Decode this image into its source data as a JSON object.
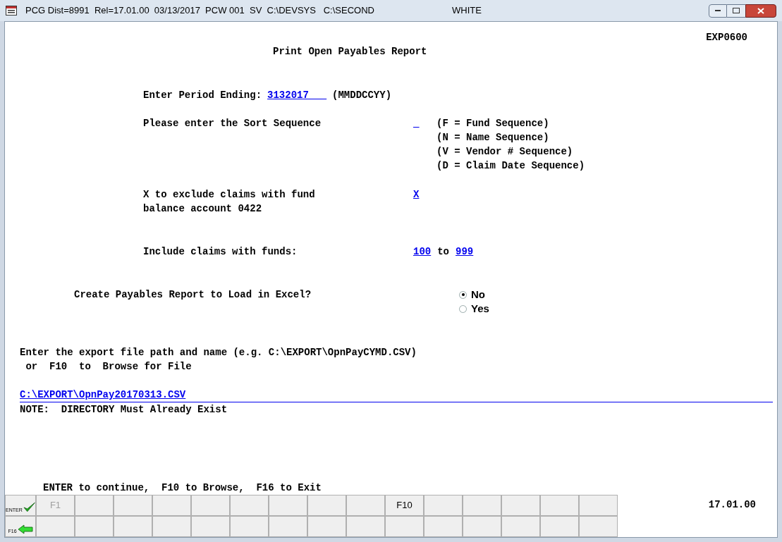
{
  "window": {
    "title": "PCG Dist=8991  Rel=17.01.00  03/13/2017  PCW 001  SV  C:\\DEVSYS   C:\\SECOND",
    "user": "WHITE"
  },
  "screen_id": "EXP0600",
  "heading": "Print Open Payables Report",
  "period": {
    "label": "Enter Period Ending:",
    "value": "3132017___",
    "hint": "(MMDDCCYY)"
  },
  "sort": {
    "label": "Please enter the Sort Sequence",
    "value": "_",
    "options": [
      "(F = Fund Sequence)",
      "(N = Name Sequence)",
      "(V = Vendor # Sequence)",
      "(D = Claim Date Sequence)"
    ]
  },
  "exclude": {
    "label_lines": [
      "X to exclude claims with fund",
      "balance account 0422"
    ],
    "value": "X"
  },
  "funds": {
    "label": "Include claims with funds:",
    "from": "100",
    "to_word": "to",
    "to": "999"
  },
  "excel": {
    "label": "Create Payables Report to Load in Excel?",
    "options": [
      {
        "label": "No",
        "selected": true
      },
      {
        "label": "Yes",
        "selected": false
      }
    ]
  },
  "export": {
    "prompt_lines": [
      "Enter the export file path and name (e.g. C:\\EXPORT\\OpnPayCYMD.CSV)",
      " or  F10  to  Browse for File"
    ],
    "path": "C:\\EXPORT\\OpnPay20170313.CSV",
    "note": "NOTE:  DIRECTORY Must Already Exist"
  },
  "instructions": "ENTER to continue,  F10 to Browse,  F16 to Exit",
  "version": "17.01.00",
  "key_rows": [
    {
      "icon_label": "ENTER",
      "kind": "check",
      "keys": [
        {
          "kind": "key",
          "label": "F1",
          "disabled": true
        },
        {
          "kind": "blank"
        },
        {
          "kind": "blank"
        },
        {
          "kind": "blank"
        },
        {
          "kind": "blank"
        },
        {
          "kind": "blank"
        },
        {
          "kind": "blank"
        },
        {
          "kind": "blank"
        },
        {
          "kind": "blank"
        },
        {
          "kind": "key",
          "label": "F10",
          "disabled": false
        },
        {
          "kind": "blank"
        },
        {
          "kind": "blank"
        },
        {
          "kind": "blank"
        },
        {
          "kind": "blank"
        },
        {
          "kind": "blank"
        }
      ]
    },
    {
      "icon_label": "F16",
      "kind": "arrow",
      "keys": [
        {
          "kind": "blank"
        },
        {
          "kind": "blank"
        },
        {
          "kind": "blank"
        },
        {
          "kind": "blank"
        },
        {
          "kind": "blank"
        },
        {
          "kind": "blank"
        },
        {
          "kind": "blank"
        },
        {
          "kind": "blank"
        },
        {
          "kind": "blank"
        },
        {
          "kind": "blank"
        },
        {
          "kind": "blank"
        },
        {
          "kind": "blank"
        },
        {
          "kind": "blank"
        },
        {
          "kind": "blank"
        },
        {
          "kind": "blank"
        }
      ]
    }
  ]
}
